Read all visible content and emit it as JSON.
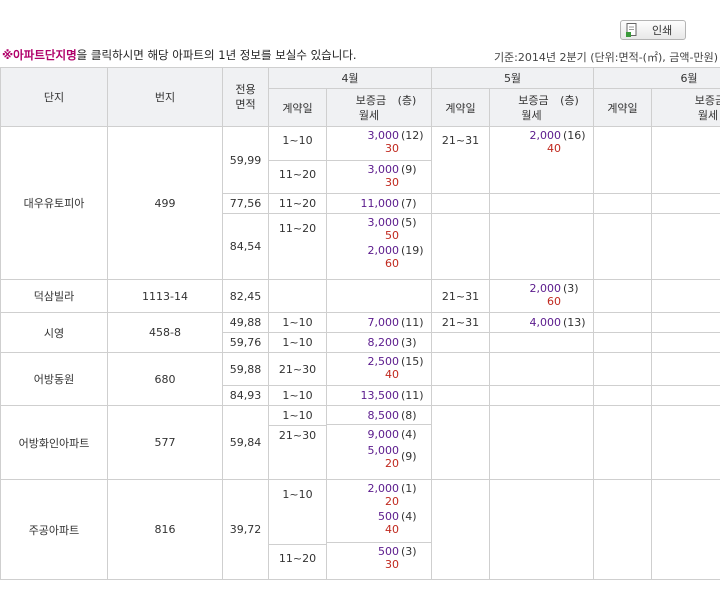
{
  "print_label": "인쇄",
  "note": {
    "mark": "※아파트단지명",
    "text": "을 클릭하시면 해당 아파트의 1년 정보를 보실수 있습니다."
  },
  "basis": "기준:2014년 2분기 (단위:면적-(㎡), 금액-만원)",
  "headers": {
    "complex": "단지",
    "lot": "번지",
    "area_line1": "전용",
    "area_line2": "면적",
    "months": [
      "4월",
      "5월",
      "6월"
    ],
    "contract_day": "계약일",
    "deposit_line1": "보증금",
    "floor_label": "(층)",
    "deposit_line2": "월세"
  },
  "rows": {
    "daewoo": {
      "name": "대우유토피아",
      "lot": "499",
      "a1": "59,99",
      "a1_r1": {
        "day": "1~10",
        "dep": "3,000",
        "mon": "30",
        "fl": "(12)"
      },
      "a1_r2": {
        "day": "11~20",
        "dep": "3,000",
        "mon": "30",
        "fl": "(9)"
      },
      "a1_may": {
        "day": "21~31",
        "dep": "2,000",
        "mon": "40",
        "fl": "(16)"
      },
      "a2": "77,56",
      "a2_r1": {
        "day": "11~20",
        "dep": "11,000",
        "fl": "(7)"
      },
      "a3": "84,54",
      "a3_r1": {
        "day": "11~20",
        "dep": "3,000",
        "mon": "50",
        "fl": "(5)"
      },
      "a3_r2": {
        "dep": "2,000",
        "mon": "60",
        "fl": "(19)"
      }
    },
    "deoksam": {
      "name": "덕삼빌라",
      "lot": "1113-14",
      "a1": "82,45",
      "may": {
        "day": "21~31",
        "dep": "2,000",
        "mon": "60",
        "fl": "(3)"
      }
    },
    "siyeong": {
      "name": "시영",
      "lot": "458-8",
      "a1": "49,88",
      "a1_r1": {
        "day": "1~10",
        "dep": "7,000",
        "fl": "(11)"
      },
      "a1_may": {
        "day": "21~31",
        "dep": "4,000",
        "fl": "(13)"
      },
      "a2": "59,76",
      "a2_r1": {
        "day": "1~10",
        "dep": "8,200",
        "fl": "(3)"
      }
    },
    "eobang": {
      "name": "어방동원",
      "lot": "680",
      "a1": "59,88",
      "a1_r1": {
        "day": "21~30",
        "dep": "2,500",
        "mon": "40",
        "fl": "(15)"
      },
      "a2": "84,93",
      "a2_r1": {
        "day": "1~10",
        "dep": "13,500",
        "fl": "(11)"
      }
    },
    "hwain": {
      "name": "어방화인아파트",
      "lot": "577",
      "a1": "59,84",
      "r1": {
        "day": "1~10",
        "dep": "8,500",
        "fl": "(8)"
      },
      "r2": {
        "day": "21~30",
        "dep": "9,000",
        "fl": "(4)"
      },
      "r3": {
        "dep": "5,000",
        "mon": "20",
        "fl": "(9)"
      }
    },
    "jugong": {
      "name": "주공아파트",
      "lot": "816",
      "a1": "39,72",
      "r1": {
        "day": "1~10",
        "dep": "2,000",
        "mon": "20",
        "fl": "(1)"
      },
      "r2": {
        "dep": "500",
        "mon": "40",
        "fl": "(4)"
      },
      "r3": {
        "day": "11~20",
        "dep": "500",
        "mon": "30",
        "fl": "(3)"
      }
    }
  }
}
